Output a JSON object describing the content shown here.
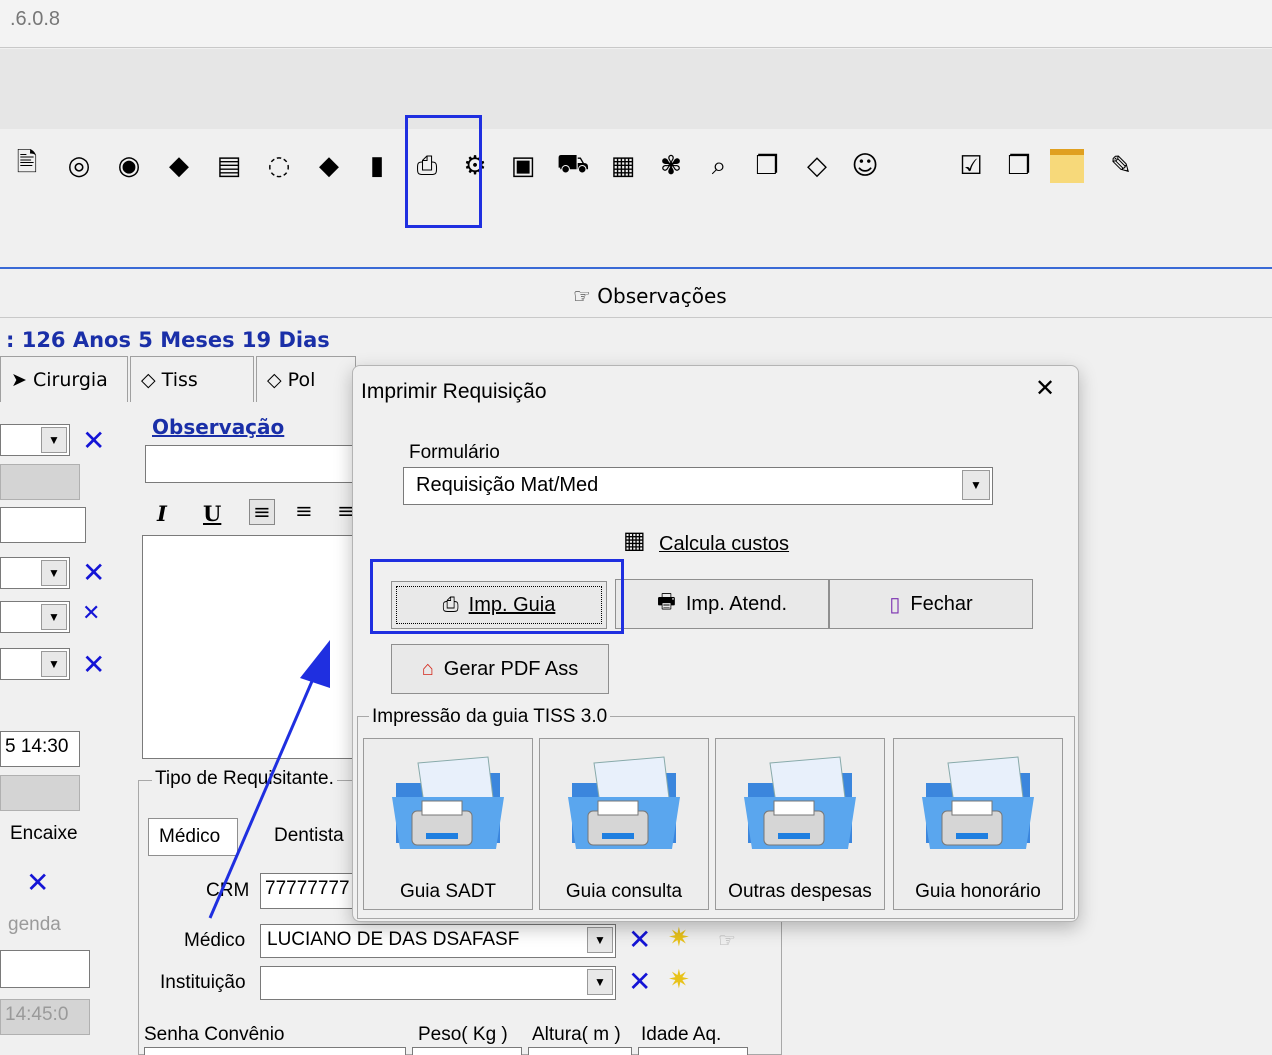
{
  "window": {
    "version": ".6.0.8"
  },
  "toolbar": {
    "icons": [
      "page-icon",
      "disc-icon",
      "disc-color-icon",
      "eraser-icon",
      "printer-stack-icon",
      "dotted-circle-icon",
      "eraser-2-icon",
      "ruler-icon",
      "printer-icon",
      "gear-tree-icon",
      "window-icon",
      "ambulance-icon",
      "calendar-grid-icon",
      "feather-icon",
      "magnifier-icon",
      "copy-icon",
      "tag-icon",
      "smiley-icon",
      "clipboard-icon",
      "documents-icon",
      "notepad-icon",
      "notes-icon"
    ]
  },
  "observacoes": {
    "label": "Observações"
  },
  "patient": {
    "age": ": 126 Anos 5 Meses 19 Dias"
  },
  "tabs": {
    "cirurgia": "Cirurgia",
    "tiss": "Tiss",
    "pol": "Pol"
  },
  "form": {
    "observacao_label": "Observação",
    "time1": "5 14:30",
    "encaixe": "Encaixe",
    "agenda": "genda",
    "time2": "14:45:0",
    "tipo_requisitante": "Tipo de Requisitante.",
    "medico_tab": "Médico",
    "dentista_tab": "Dentista",
    "crm_label": "CRM",
    "crm_value": "77777777",
    "medico_label": "Médico",
    "medico_value": "LUCIANO DE DAS DSAFASF",
    "instituicao_label": "Instituição",
    "instituicao_value": "",
    "senha_label": "Senha Convênio",
    "peso_label": "Peso( Kg )",
    "altura_label": "Altura( m )",
    "idade_label": "Idade Aq."
  },
  "dialog": {
    "title": "Imprimir Requisição",
    "formulario_label": "Formulário",
    "formulario_value": "Requisição Mat/Med",
    "calcula_custos": "Calcula custos",
    "imp_guia": "Imp. Guia",
    "imp_atend": "Imp. Atend.",
    "fechar": "Fechar",
    "gerar_pdf": "Gerar PDF Ass",
    "tiss_group": "Impressão da guia TISS 3.0",
    "tiss_buttons": [
      "Guia SADT",
      "Guia consulta",
      "Outras despesas",
      "Guia honorário"
    ]
  },
  "colors": {
    "highlight": "#1f2fe0",
    "accent_text": "#1a2fa8",
    "x_blue": "#1414d6"
  }
}
